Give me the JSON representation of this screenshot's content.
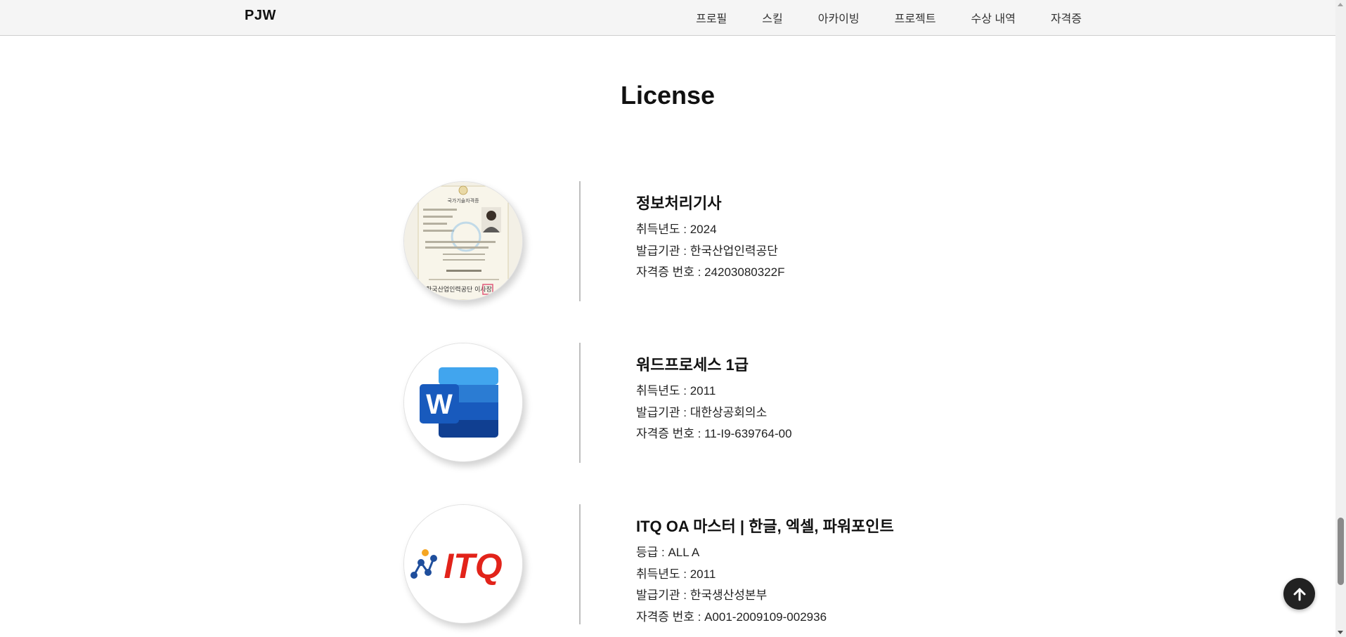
{
  "brand": "PJW",
  "nav": {
    "items": [
      {
        "label": "프로필"
      },
      {
        "label": "스킬"
      },
      {
        "label": "아카이빙"
      },
      {
        "label": "프로젝트"
      },
      {
        "label": "수상 내역"
      },
      {
        "label": "자격증"
      }
    ]
  },
  "section": {
    "title": "License"
  },
  "licenses": [
    {
      "name": "정보처리기사",
      "year": "취득년도 : 2024",
      "issuer": "발급기관 : 한국산업인력공단",
      "number": "자격증 번호 : 24203080322F",
      "image_icon": "certificate-photo",
      "image_text": {
        "header": "국가기술자격증",
        "org": "한국산업인력공단 이사장"
      }
    },
    {
      "name": "워드프로세스 1급",
      "year": "취득년도 : 2011",
      "issuer": "발급기관 : 대한상공회의소",
      "number": "자격증 번호 : 11-I9-639764-00",
      "image_icon": "word-logo",
      "logo_letter": "W"
    },
    {
      "name": "ITQ OA 마스터 | 한글, 엑셀, 파워포인트",
      "grade": "등급 : ALL A",
      "year": "취득년도 : 2011",
      "issuer": "발급기관 : 한국생산성본부",
      "number": "자격증 번호 : A001-2009109-002936",
      "image_icon": "itq-logo",
      "logo_text": "ITQ"
    }
  ],
  "colors": {
    "navbar_bg": "#f5f5f5",
    "word_blue": "#185abd",
    "itq_red": "#e2231a",
    "itq_blue": "#1f4e9c",
    "itq_orange": "#f5a623",
    "top_button": "#222222"
  },
  "icons": {
    "top_button": "arrow-up-icon"
  }
}
